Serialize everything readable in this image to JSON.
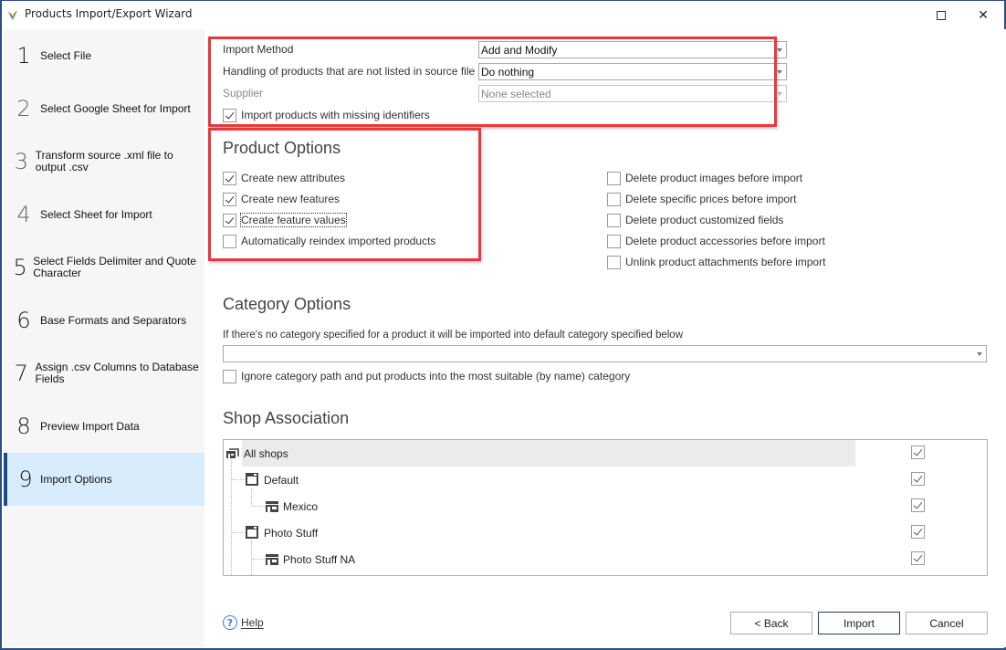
{
  "window": {
    "title": "Products Import/Export Wizard",
    "maximize_icon": "maximize-icon",
    "close_icon": "close-icon"
  },
  "sidebar": {
    "active_step": 9,
    "steps": [
      {
        "num": "1",
        "label": "Select File"
      },
      {
        "num": "2",
        "label": "Select Google Sheet for Import"
      },
      {
        "num": "3",
        "label": "Transform source .xml file to output .csv"
      },
      {
        "num": "4",
        "label": "Select Sheet for Import"
      },
      {
        "num": "5",
        "label": "Select Fields Delimiter and Quote Character"
      },
      {
        "num": "6",
        "label": "Base Formats and Separators"
      },
      {
        "num": "7",
        "label": "Assign .csv Columns to Database Fields"
      },
      {
        "num": "8",
        "label": "Preview Import Data"
      },
      {
        "num": "9",
        "label": "Import Options"
      }
    ]
  },
  "import_settings": {
    "import_method_label": "Import Method",
    "import_method_value": "Add and Modify",
    "handling_label": "Handling of products that are not listed in source file",
    "handling_value": "Do nothing",
    "supplier_label": "Supplier",
    "supplier_value": "None selected",
    "missing_identifiers": {
      "label": "Import products with missing identifiers",
      "checked": true
    }
  },
  "product_options": {
    "title": "Product Options",
    "left": [
      {
        "label": "Create new attributes",
        "checked": true
      },
      {
        "label": "Create new features",
        "checked": true
      },
      {
        "label": "Create feature values",
        "checked": true
      },
      {
        "label": "Automatically reindex imported products",
        "checked": false
      }
    ],
    "right": [
      {
        "label": "Delete product images before import",
        "checked": false
      },
      {
        "label": "Delete specific prices before import",
        "checked": false
      },
      {
        "label": "Delete product customized fields",
        "checked": false
      },
      {
        "label": "Delete product accessories before import",
        "checked": false
      },
      {
        "label": "Unlink product attachments before import",
        "checked": false
      }
    ]
  },
  "category_options": {
    "title": "Category Options",
    "description": "If there's no category specified for a product it will be imported into default category specified below",
    "default_category_value": "",
    "ignore_path": {
      "label": "Ignore category path and put products into the most suitable (by name) category",
      "checked": false
    }
  },
  "shop_association": {
    "title": "Shop Association",
    "items": [
      {
        "label": "All shops",
        "level": 0,
        "icon": "shop-group-icon",
        "checked": true
      },
      {
        "label": "Default",
        "level": 1,
        "icon": "shop-window-icon",
        "checked": true
      },
      {
        "label": "Mexico",
        "level": 2,
        "icon": "store-icon",
        "checked": true
      },
      {
        "label": "Photo Stuff",
        "level": 1,
        "icon": "shop-window-icon",
        "checked": true
      },
      {
        "label": "Photo Stuff NA",
        "level": 2,
        "icon": "store-icon",
        "checked": true
      }
    ]
  },
  "footer": {
    "help_label": "Help",
    "back_label": "< Back",
    "import_label": "Import",
    "cancel_label": "Cancel"
  },
  "colors": {
    "highlight_border": "#e8383d",
    "active_step_bg": "#d9ecfc",
    "active_step_bar": "#1e4a8c",
    "window_border": "#2b4f7e"
  }
}
